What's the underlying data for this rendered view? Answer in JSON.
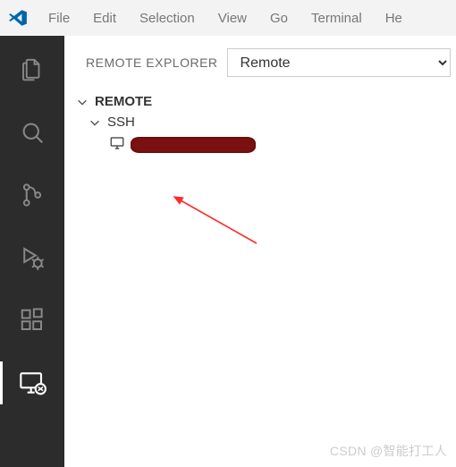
{
  "menubar": {
    "items": [
      {
        "label": "File"
      },
      {
        "label": "Edit"
      },
      {
        "label": "Selection"
      },
      {
        "label": "View"
      },
      {
        "label": "Go"
      },
      {
        "label": "Terminal"
      },
      {
        "label": "He"
      }
    ]
  },
  "activitybar": {
    "items": [
      {
        "name": "explorer",
        "active": false
      },
      {
        "name": "search",
        "active": false
      },
      {
        "name": "source-control",
        "active": false
      },
      {
        "name": "run-debug",
        "active": false
      },
      {
        "name": "extensions",
        "active": false
      },
      {
        "name": "remote-explorer",
        "active": true
      }
    ]
  },
  "sidebar": {
    "title": "REMOTE EXPLORER",
    "dropdown": {
      "value": "Remote"
    },
    "tree": {
      "remote_label": "REMOTE",
      "ssh_label": "SSH",
      "host_redacted": true
    }
  },
  "watermark": "CSDN @智能打工人",
  "colors": {
    "accent": "#0065A9",
    "activitybar_bg": "#2c2c2c",
    "menu_bg": "#f3f3f3"
  }
}
